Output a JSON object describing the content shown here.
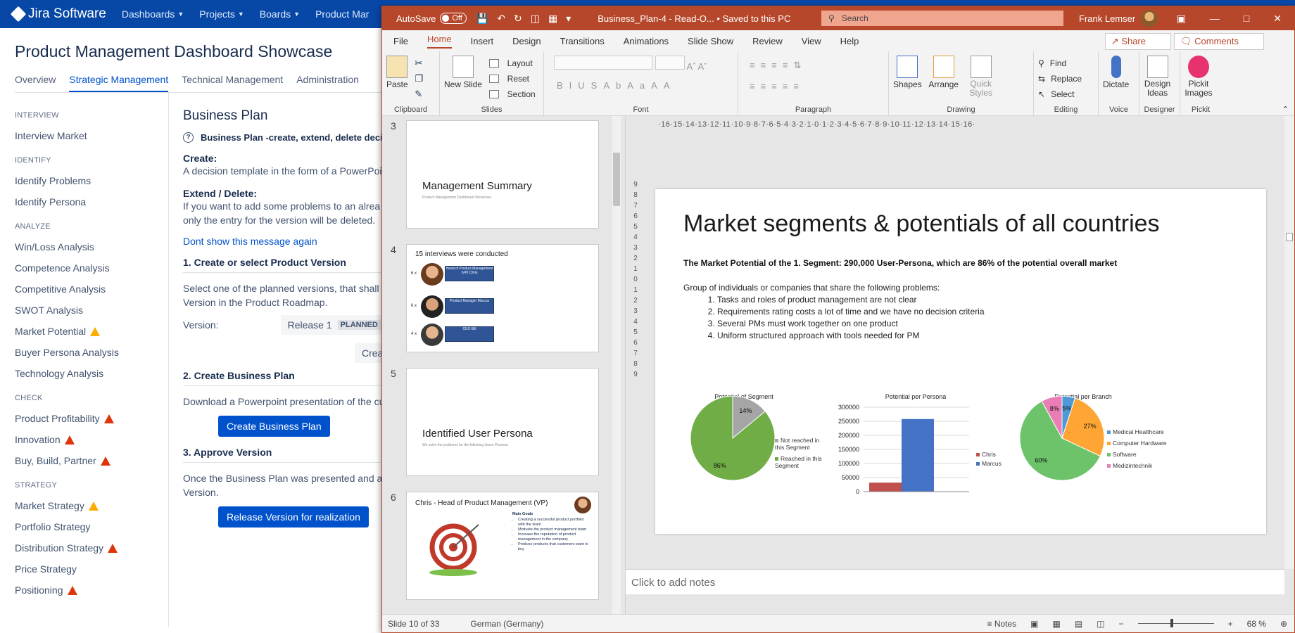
{
  "jira": {
    "brand": "Jira Software",
    "nav": [
      "Dashboards",
      "Projects",
      "Boards",
      "Product Mar"
    ],
    "title": "Product Management Dashboard Showcase",
    "tabs": [
      "Overview",
      "Strategic Management",
      "Technical Management",
      "Administration"
    ],
    "sidebar": [
      {
        "section": "INTERVIEW",
        "items": [
          {
            "label": "Interview Market",
            "warn": ""
          }
        ]
      },
      {
        "section": "IDENTIFY",
        "items": [
          {
            "label": "Identify Problems",
            "warn": ""
          },
          {
            "label": "Identify Persona",
            "warn": ""
          }
        ]
      },
      {
        "section": "ANALYZE",
        "items": [
          {
            "label": "Win/Loss Analysis",
            "warn": ""
          },
          {
            "label": "Competence Analysis",
            "warn": ""
          },
          {
            "label": "Competitive Analysis",
            "warn": ""
          },
          {
            "label": "SWOT Analysis",
            "warn": ""
          },
          {
            "label": "Market Potential",
            "warn": "yellow"
          },
          {
            "label": "Buyer Persona Analysis",
            "warn": ""
          },
          {
            "label": "Technology Analysis",
            "warn": ""
          }
        ]
      },
      {
        "section": "CHECK",
        "items": [
          {
            "label": "Product Profitability",
            "warn": "red"
          },
          {
            "label": "Innovation",
            "warn": "red"
          },
          {
            "label": "Buy, Build, Partner",
            "warn": "red"
          }
        ]
      },
      {
        "section": "STRATEGY",
        "items": [
          {
            "label": "Market Strategy",
            "warn": "yellow"
          },
          {
            "label": "Portfolio Strategy",
            "warn": ""
          },
          {
            "label": "Distribution Strategy",
            "warn": "red"
          },
          {
            "label": "Price Strategy",
            "warn": ""
          },
          {
            "label": "Positioning",
            "warn": "red"
          }
        ]
      }
    ],
    "main": {
      "heading": "Business Plan",
      "info": "Business Plan -create, extend, delete deci",
      "create_h": "Create:",
      "create_t": "A decision template in the form of a PowerPoi",
      "ext_h": "Extend / Delete:",
      "ext_t1": "If you want to add some problems to an alrea",
      "ext_t2": "only the entry for the version will be deleted.",
      "link": "Dont show this message again",
      "step1": "1. Create or select Product Version",
      "step1_t1": "Select one of the planned versions, that shall b",
      "step1_t2": "Version in the Product Roadmap.",
      "version_label": "Version:",
      "version_value": "Release 1",
      "version_badge": "PLANNED",
      "create_btn_cut": "Creat",
      "step2": "2. Create Business Plan",
      "step2_t": "Download a Powerpoint presentation of the cu",
      "create_bp_btn": "Create Business Plan",
      "step3": "3. Approve Version",
      "step3_t1": "Once the Business Plan was presented and ac",
      "step3_t2": "Version.",
      "release_btn": "Release Version for realization"
    }
  },
  "ppt": {
    "autosave": "AutoSave",
    "autosave_state": "Off",
    "doc_title": "Business_Plan-4  -  Read-O...  •  Saved to this PC",
    "search_placeholder": "Search",
    "user": "Frank Lemser",
    "menu": [
      "File",
      "Home",
      "Insert",
      "Design",
      "Transitions",
      "Animations",
      "Slide Show",
      "Review",
      "View",
      "Help"
    ],
    "share": "Share",
    "comments": "Comments",
    "groups": {
      "clipboard": "Clipboard",
      "slides": "Slides",
      "font": "Font",
      "paragraph": "Paragraph",
      "drawing": "Drawing",
      "editing": "Editing",
      "voice": "Voice",
      "designer": "Designer",
      "pickit": "Pickit"
    },
    "buttons": {
      "paste": "Paste",
      "new_slide": "New Slide",
      "layout": "Layout",
      "reset": "Reset",
      "section": "Section",
      "shapes": "Shapes",
      "arrange": "Arrange",
      "quick_styles": "Quick Styles",
      "find": "Find",
      "replace": "Replace",
      "select": "Select",
      "dictate": "Dictate",
      "design_ideas": "Design Ideas",
      "pickit_images": "Pickit Images"
    },
    "thumbs": [
      {
        "num": "3",
        "title": "Management Summary",
        "sub": "Product Management Dashboard Showcase"
      },
      {
        "num": "4",
        "title": "15 interviews were conducted",
        "rows": [
          {
            "count": "6 x",
            "label": "Head of Product Management (VP) Chris"
          },
          {
            "count": "6 x",
            "label": "Product Manager Marcus"
          },
          {
            "count": "4 x",
            "label": "CEO Bill"
          }
        ]
      },
      {
        "num": "5",
        "title": "Identified User Persona",
        "sub": "We solve the problems for the following Users Persona"
      },
      {
        "num": "6",
        "title": "Chris - Head of Product Management (VP)",
        "goals_title": "Main Goals",
        "goals": [
          "Creating a successful product portfolio with the team",
          "Motivate the product management team",
          "Increase the reputation of product management in the company",
          "Produce products that customers want to buy"
        ]
      }
    ],
    "slide": {
      "title": "Market segments & potentials of all countries",
      "subtitle": "The Market Potential of the 1. Segment: 290,000 User-Persona, which are 86% of the potential overall market",
      "intro": "Group of individuals or companies that share the following problems:",
      "problems": [
        "Tasks and roles of product management are not clear",
        "Requirements rating costs a lot of time and we have no decision criteria",
        "Several PMs must work together on one product",
        "Uniform structured approach with tools needed for PM"
      ]
    },
    "notes": "Click to add notes",
    "status": {
      "slide": "Slide 10 of 33",
      "lang": "German (Germany)",
      "notes": "Notes",
      "zoom": "68 %"
    },
    "colors": {
      "accent": "#b7472a",
      "green": "#70ad47",
      "blue": "#4472c4",
      "grey": "#a5a5a5",
      "red": "#c0504d",
      "orange": "#ffa534",
      "pink": "#e87eb5",
      "lightblue": "#4f9ad6",
      "lightgreen": "#6cc36a"
    }
  },
  "chart_data": [
    {
      "type": "pie",
      "title": "Potential of Segment",
      "categories": [
        "Not reached in this Segment",
        "Reached in this Segment"
      ],
      "values": [
        14,
        86
      ],
      "labels": [
        "14%",
        "86%"
      ],
      "legend": "right"
    },
    {
      "type": "bar",
      "title": "Potential per Persona",
      "categories": [
        ""
      ],
      "series": [
        {
          "name": "Chris",
          "values": [
            32000
          ]
        },
        {
          "name": "Marcus",
          "values": [
            258000
          ]
        }
      ],
      "ylim": [
        0,
        300000
      ],
      "yticks": [
        "0",
        "50000",
        "100000",
        "150000",
        "200000",
        "250000",
        "300000"
      ],
      "grid": true,
      "legend": "right"
    },
    {
      "type": "pie",
      "title": "Potential per Branch",
      "categories": [
        "Medical Healthcare",
        "Computer Hardware",
        "Software",
        "Medizintechnik"
      ],
      "values": [
        5,
        27,
        60,
        8
      ],
      "labels": [
        "5%",
        "27%",
        "60%",
        "8%"
      ],
      "legend": "right"
    }
  ]
}
